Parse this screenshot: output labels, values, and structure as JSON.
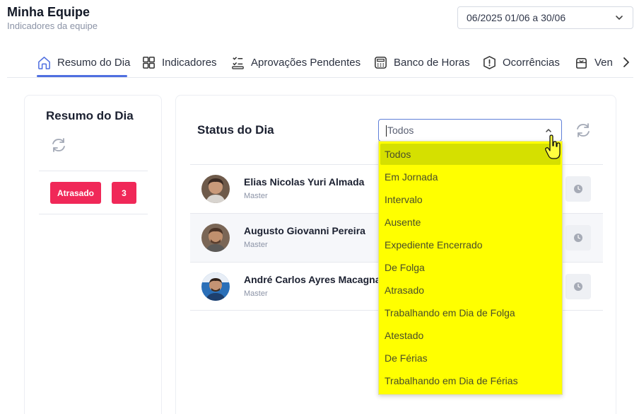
{
  "header": {
    "title": "Minha Equipe",
    "subtitle": "Indicadores da equipe"
  },
  "period_select": {
    "value": "06/2025  01/06 a 30/06"
  },
  "tabs": [
    {
      "label": "Resumo do Dia",
      "icon": "home-icon",
      "active": true
    },
    {
      "label": "Indicadores",
      "icon": "grid-icon"
    },
    {
      "label": "Aprovações Pendentes",
      "icon": "approval-list-icon"
    },
    {
      "label": "Banco de Horas",
      "icon": "calculator-icon"
    },
    {
      "label": "Ocorrências",
      "icon": "alert-icon"
    },
    {
      "label": "Ven",
      "icon": "bag-icon"
    }
  ],
  "summary_card": {
    "title": "Resumo do Dia",
    "status_label": "Atrasado",
    "status_count": "3"
  },
  "status_card": {
    "title": "Status do Dia",
    "select_value": "Todos"
  },
  "employees": [
    {
      "name": "Elias Nicolas Yuri Almada",
      "role": "Master"
    },
    {
      "name": "Augusto Giovanni Pereira",
      "role": "Master"
    },
    {
      "name": "André Carlos Ayres Macagnani",
      "role": "Master"
    }
  ],
  "dropdown": {
    "options": [
      "Todos",
      "Em Jornada",
      "Intervalo",
      "Ausente",
      "Expediente Encerrado",
      "De Folga",
      "Atrasado",
      "Trabalhando em Dia de Folga",
      "Atestado",
      "De Férias",
      "Trabalhando em Dia de Férias"
    ],
    "highlighted": "Todos"
  },
  "colors": {
    "accent": "#4f6fe0",
    "badge": "#f02858",
    "dropdown_bg": "#ffff00",
    "dropdown_highlight": "#d5e000"
  }
}
